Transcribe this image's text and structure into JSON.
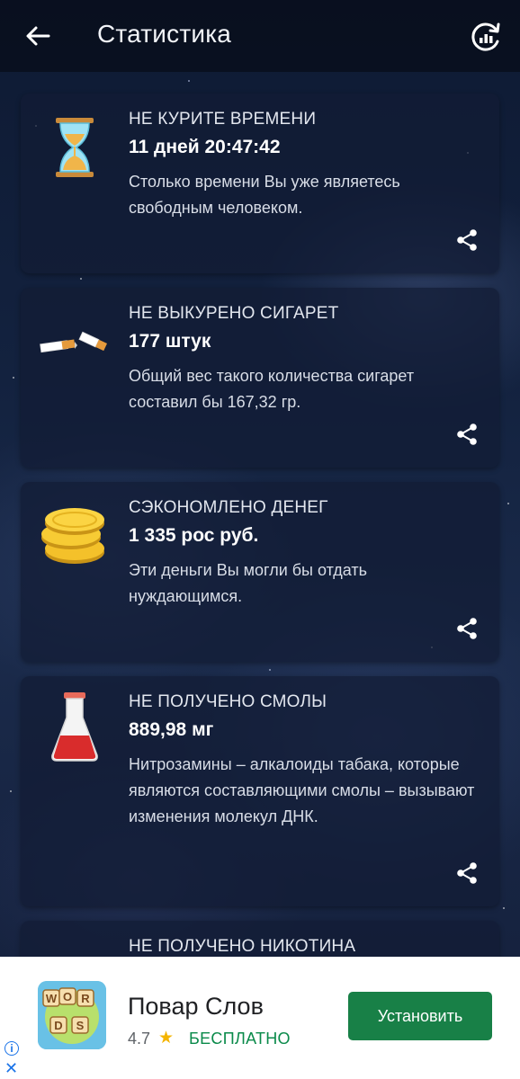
{
  "header": {
    "title": "Статистика",
    "back_icon": "arrow-left-icon",
    "stats_icon": "refresh-chart-icon"
  },
  "cards": [
    {
      "icon": "hourglass-icon",
      "label": "НЕ КУРИТЕ ВРЕМЕНИ",
      "value": "11 дней 20:47:42",
      "description": "Столько времени Вы уже являетесь свободным человеком."
    },
    {
      "icon": "broken-cigarette-icon",
      "label": "НЕ ВЫКУРЕНО СИГАРЕТ",
      "value": "177 штук",
      "description": "Общий вес такого количества сигарет составил бы 167,32 гр."
    },
    {
      "icon": "coins-icon",
      "label": "СЭКОНОМЛЕНО ДЕНЕГ",
      "value": "1 335 рос руб.",
      "description": "Эти деньги Вы могли бы отдать нуждающимся."
    },
    {
      "icon": "flask-icon",
      "label": "НЕ ПОЛУЧЕНО СМОЛЫ",
      "value": "889,98 мг",
      "description": "Нитрозамины – алкалоиды табака, которые являются составляющими смолы – вызывают изменения молекул ДНК."
    },
    {
      "icon": "purple-triangle-icon",
      "label": "НЕ ПОЛУЧЕНО НИКОТИНА"
    }
  ],
  "ad": {
    "app_name": "Повар Слов",
    "rating": "4.7",
    "price": "БЕСПЛАТНО",
    "install_label": "Установить",
    "icon": "words-game-icon",
    "icon_letters": [
      "W",
      "O",
      "R",
      "D",
      "S"
    ],
    "info_icon": "info-icon",
    "close_icon": "close-icon"
  },
  "colors": {
    "install_button": "#188047",
    "free_text": "#0a8a4a",
    "star": "#f4b400"
  }
}
